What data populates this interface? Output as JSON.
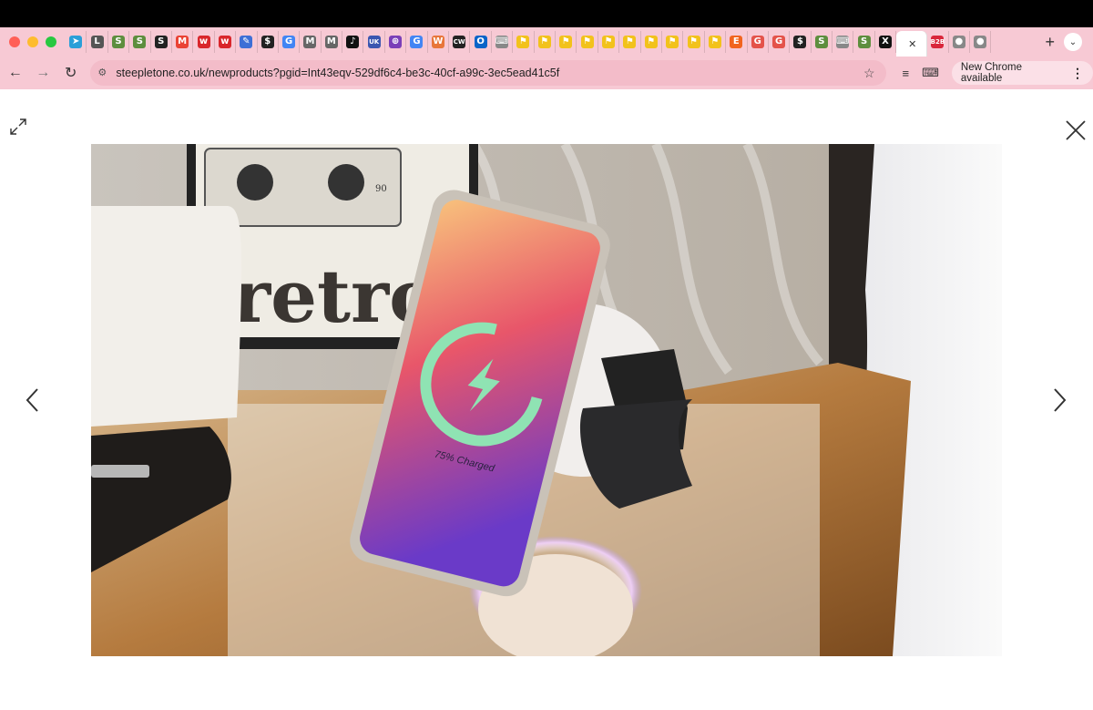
{
  "browser": {
    "url": "steepletone.co.uk/newproducts?pgid=Int43eqv-529df6c4-be3c-40cf-a99c-3ec5ead41c5f",
    "update_label": "New Chrome available",
    "tabs": [
      {
        "icon": "telegram-icon",
        "glyph": "➤",
        "bg": "#2a9fd8"
      },
      {
        "icon": "l-icon",
        "glyph": "L",
        "bg": "#555"
      },
      {
        "icon": "shopify-icon",
        "glyph": "S",
        "bg": "#5e8e3e"
      },
      {
        "icon": "shopify-icon",
        "glyph": "S",
        "bg": "#5e8e3e"
      },
      {
        "icon": "s-icon",
        "glyph": "S",
        "bg": "#222"
      },
      {
        "icon": "gmail-icon",
        "glyph": "M",
        "bg": "#ea4335"
      },
      {
        "icon": "wps-icon",
        "glyph": "w",
        "bg": "#d9262b"
      },
      {
        "icon": "wps-icon",
        "glyph": "w",
        "bg": "#d9262b"
      },
      {
        "icon": "pen-icon",
        "glyph": "✎",
        "bg": "#3d6fd6"
      },
      {
        "icon": "shopping-bag-icon",
        "glyph": "$",
        "bg": "#222"
      },
      {
        "icon": "google-icon",
        "glyph": "G",
        "bg": "#4285f4"
      },
      {
        "icon": "m-icon",
        "glyph": "M",
        "bg": "#666"
      },
      {
        "icon": "m-icon",
        "glyph": "M",
        "bg": "#666"
      },
      {
        "icon": "tiktok-icon",
        "glyph": "♪",
        "bg": "#111"
      },
      {
        "icon": "uk-icon",
        "glyph": "UK",
        "bg": "#3a56b0"
      },
      {
        "icon": "crosshair-icon",
        "glyph": "⊕",
        "bg": "#7a3fb8"
      },
      {
        "icon": "google-icon",
        "glyph": "G",
        "bg": "#4285f4"
      },
      {
        "icon": "w-icon",
        "glyph": "W",
        "bg": "#e8763a"
      },
      {
        "icon": "cw-icon",
        "glyph": "CW",
        "bg": "#222"
      },
      {
        "icon": "outlook-icon",
        "glyph": "O",
        "bg": "#0a64c8"
      },
      {
        "icon": "keyboard-icon",
        "glyph": "⌨",
        "bg": "#888"
      },
      {
        "icon": "flag-icon",
        "glyph": "⚑",
        "bg": "#f2c21b"
      },
      {
        "icon": "flag-icon",
        "glyph": "⚑",
        "bg": "#f2c21b"
      },
      {
        "icon": "flag-icon",
        "glyph": "⚑",
        "bg": "#f2c21b"
      },
      {
        "icon": "flag-icon",
        "glyph": "⚑",
        "bg": "#f2c21b"
      },
      {
        "icon": "flag-icon",
        "glyph": "⚑",
        "bg": "#f2c21b"
      },
      {
        "icon": "flag-icon",
        "glyph": "⚑",
        "bg": "#f2c21b"
      },
      {
        "icon": "flag-icon",
        "glyph": "⚑",
        "bg": "#f2c21b"
      },
      {
        "icon": "flag-icon",
        "glyph": "⚑",
        "bg": "#f2c21b"
      },
      {
        "icon": "flag-icon",
        "glyph": "⚑",
        "bg": "#f2c21b"
      },
      {
        "icon": "flag-icon",
        "glyph": "⚑",
        "bg": "#f2c21b"
      },
      {
        "icon": "etsy-icon",
        "glyph": "E",
        "bg": "#f1641e"
      },
      {
        "icon": "g-red-icon",
        "glyph": "G",
        "bg": "#e4534a"
      },
      {
        "icon": "g-red-icon",
        "glyph": "G",
        "bg": "#e4534a"
      },
      {
        "icon": "shopping-bag-icon",
        "glyph": "$",
        "bg": "#222"
      },
      {
        "icon": "shopify-icon",
        "glyph": "S",
        "bg": "#5e8e3e"
      },
      {
        "icon": "keyboard-icon",
        "glyph": "⌨",
        "bg": "#888"
      },
      {
        "icon": "shopify-icon",
        "glyph": "S",
        "bg": "#5e8e3e"
      },
      {
        "icon": "x-icon",
        "glyph": "X",
        "bg": "#111"
      }
    ],
    "tabs_after": [
      {
        "icon": "b2b-icon",
        "glyph": "B2B",
        "bg": "#d9263a"
      },
      {
        "icon": "apple-icon",
        "glyph": "●",
        "bg": "#888"
      },
      {
        "icon": "apple-icon",
        "glyph": "●",
        "bg": "#888"
      }
    ]
  },
  "photo": {
    "frame_number": "90",
    "poster_word": "retro",
    "phone_status": "75% Charged"
  }
}
